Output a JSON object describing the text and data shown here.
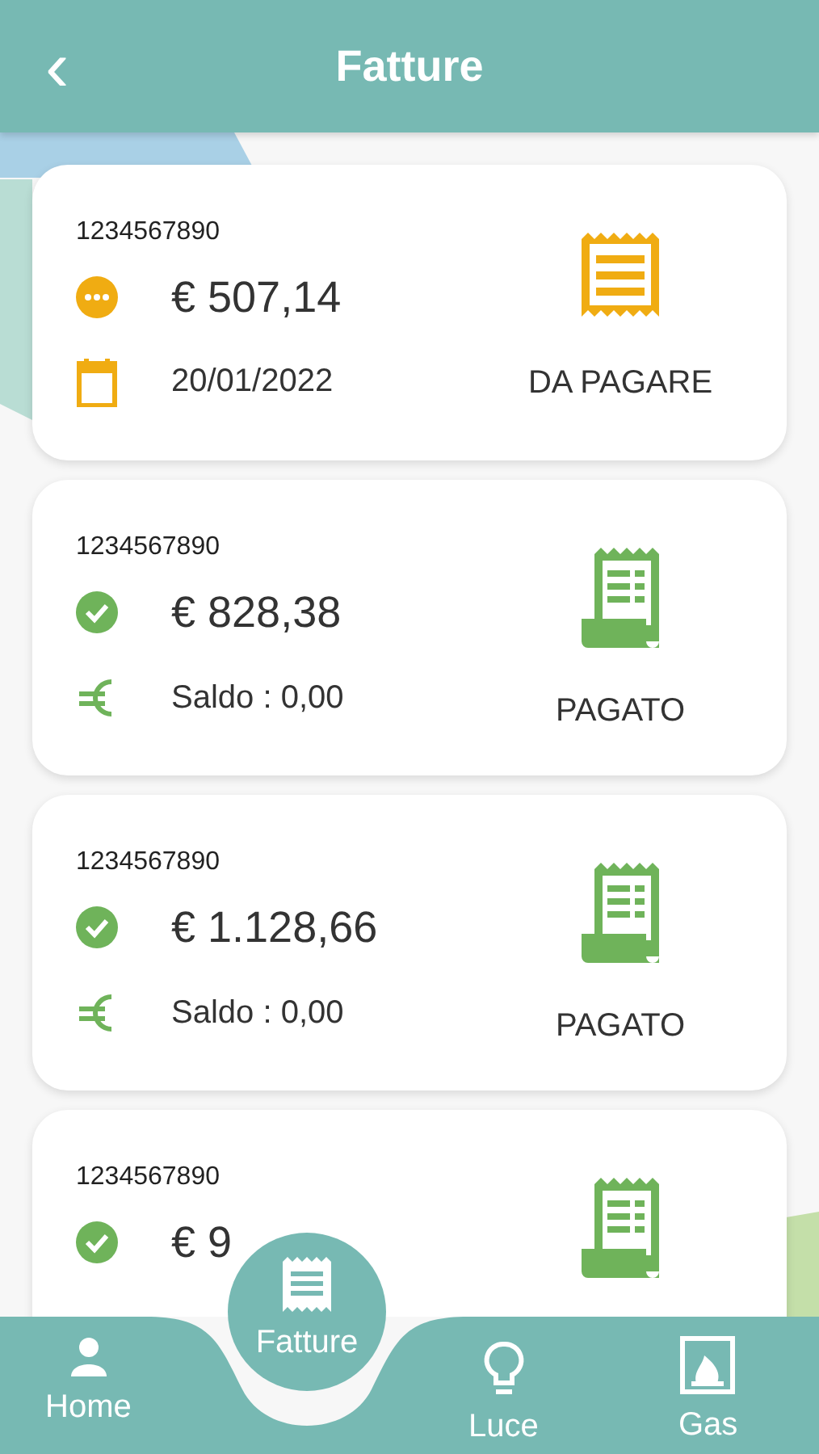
{
  "header": {
    "title": "Fatture",
    "back": "‹"
  },
  "invoices": [
    {
      "kind": "unpaid",
      "number": "1234567890",
      "amount": "€ 507,14",
      "detail": "20/01/2022",
      "status": "DA PAGARE"
    },
    {
      "kind": "paid",
      "number": "1234567890",
      "amount": "€ 828,38",
      "detail": "Saldo : 0,00",
      "status": "PAGATO"
    },
    {
      "kind": "paid",
      "number": "1234567890",
      "amount": "€ 1.128,66",
      "detail": "Saldo : 0,00",
      "status": "PAGATO"
    },
    {
      "kind": "paid",
      "number": "1234567890",
      "amount": "€ 9"
    }
  ],
  "tabs": [
    {
      "kind": "home",
      "label": "Home",
      "selected": false
    },
    {
      "kind": "invoices",
      "label": "Fatture",
      "selected": true
    },
    {
      "kind": "light",
      "label": "Luce",
      "selected": false
    },
    {
      "kind": "gas",
      "label": "Gas",
      "selected": false
    }
  ]
}
